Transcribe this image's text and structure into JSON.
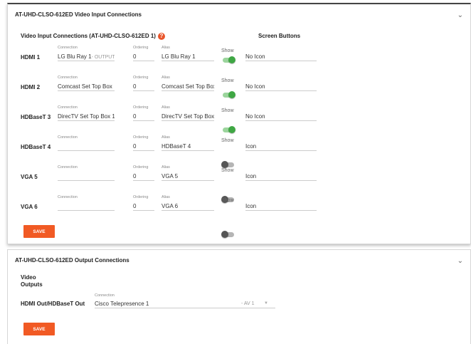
{
  "inputs_panel": {
    "title": "AT-UHD-CLSO-612ED Video Input Connections",
    "collapse_icon": "chevron-down-icon",
    "section_title": "Video Input Connections (AT-UHD-CLSO-612ED 1)",
    "help_icon": "help-icon",
    "help_glyph": "?",
    "screen_buttons_title": "Screen Buttons",
    "save_label": "SAVE",
    "rows": [
      {
        "label": "HDMI 1",
        "connection_label": "Connection",
        "connection": "LG Blu Ray 1",
        "connection_suffix": "- OUTPUT",
        "ordering_label": "Ordering",
        "ordering": "0",
        "alias_label": "Alias",
        "alias": "LG Blu Ray 1",
        "show_label": "Show",
        "show": true,
        "screen_button": "No Icon"
      },
      {
        "label": "HDMI 2",
        "connection_label": "Connection",
        "connection": "Comcast Set Top Box",
        "connection_suffix": "",
        "ordering_label": "Ordering",
        "ordering": "0",
        "alias_label": "Alias",
        "alias": "Comcast Set Top Box",
        "show_label": "Show",
        "show": true,
        "screen_button": "No Icon"
      },
      {
        "label": "HDBaseT 3",
        "connection_label": "Connection",
        "connection": "DirecTV Set Top Box 1",
        "connection_suffix": "",
        "ordering_label": "Ordering",
        "ordering": "0",
        "alias_label": "Alias",
        "alias": "DirecTV Set Top Box",
        "show_label": "Show",
        "show": true,
        "screen_button": "No Icon"
      },
      {
        "label": "HDBaseT 4",
        "connection_label": "Connection",
        "connection": "",
        "connection_suffix": "",
        "ordering_label": "Ordering",
        "ordering": "0",
        "alias_label": "Alias",
        "alias": "HDBaseT 4",
        "show_label": "Show",
        "show": false,
        "screen_button": "Icon"
      },
      {
        "label": "VGA 5",
        "connection_label": "Connection",
        "connection": "",
        "connection_suffix": "",
        "ordering_label": "Ordering",
        "ordering": "0",
        "alias_label": "Alias",
        "alias": "VGA 5",
        "show_label": "Show",
        "show": false,
        "screen_button": "Icon"
      },
      {
        "label": "VGA 6",
        "connection_label": "Connection",
        "connection": "",
        "connection_suffix": "",
        "ordering_label": "Ordering",
        "ordering": "0",
        "alias_label": "Alias",
        "alias": "VGA 6",
        "show_label": "Show",
        "show": false,
        "screen_button": "Icon"
      }
    ]
  },
  "outputs_panel": {
    "title": "AT-UHD-CLSO-612ED Output Connections",
    "collapse_icon": "chevron-down-icon",
    "section_title_line1": "Video",
    "section_title_line2": "Outputs",
    "row_label": "HDMI Out/HDBaseT Out",
    "connection_label": "Connection",
    "connection": "Cisco Telepresence 1",
    "connection_suffix": "- AV 1",
    "dropdown_icon": "caret-down-icon",
    "save_label": "SAVE"
  },
  "colors": {
    "accent": "#f15a24",
    "toggle_on": "#3fa744",
    "toggle_off": "#555555"
  }
}
